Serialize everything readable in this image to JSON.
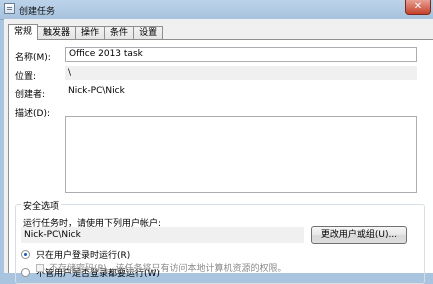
{
  "window": {
    "title": "创建任务",
    "close_symbol": "✕"
  },
  "tabs": [
    {
      "label": "常规"
    },
    {
      "label": "触发器"
    },
    {
      "label": "操作"
    },
    {
      "label": "条件"
    },
    {
      "label": "设置"
    }
  ],
  "general": {
    "name_label": "名称(M):",
    "name_value": "Office 2013 task",
    "location_label": "位置:",
    "location_value": "\\",
    "author_label": "创建者:",
    "author_value": "Nick-PC\\Nick",
    "description_label": "描述(D):",
    "description_value": ""
  },
  "security": {
    "group_title": "安全选项",
    "run_as_label": "运行任务时，请使用下列用户帐户:",
    "user_value": "Nick-PC\\Nick",
    "change_user_button": "更改用户或组(U)...",
    "option_logged_on": "只在用户登录时运行(R)",
    "option_whether_logged_on": "不管用户是否登录都要运行(W)",
    "selected_option": "option_logged_on",
    "store_password_label": "不存储密码(P)。该任务将只有访问本地计算机资源的权限。"
  },
  "icons": {
    "window_icon": "task-window-icon",
    "close_icon": "close-icon"
  }
}
